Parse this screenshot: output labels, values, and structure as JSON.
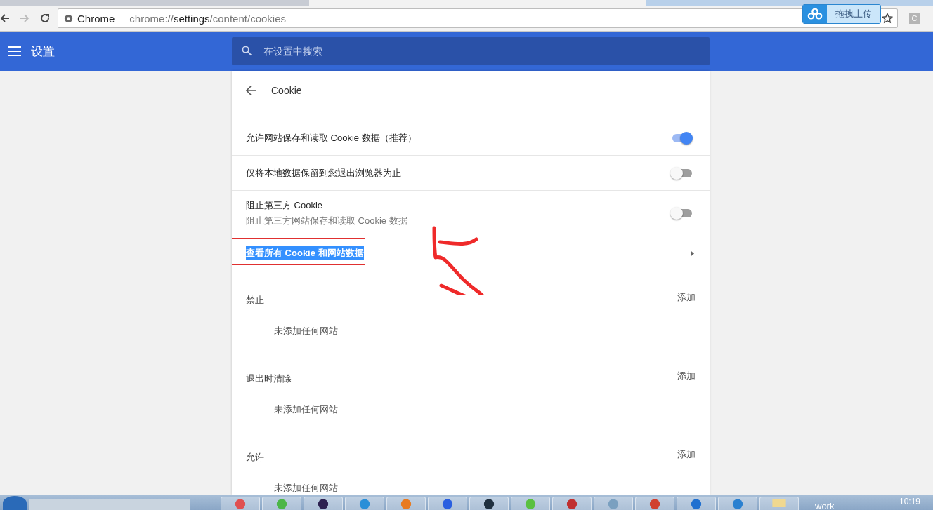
{
  "browser": {
    "origin": "Chrome",
    "url_scheme": "chrome://",
    "url_host": "settings",
    "url_path": "/content/cookies",
    "extension_label": "拖拽上传",
    "profile_badge": "C"
  },
  "header": {
    "title": "设置",
    "search_placeholder": "在设置中搜索"
  },
  "page": {
    "title": "Cookie"
  },
  "toggles": [
    {
      "label": "允许网站保存和读取 Cookie 数据（推荐）",
      "on": true
    },
    {
      "label": "仅将本地数据保留到您退出浏览器为止",
      "on": false
    },
    {
      "label": "阻止第三方 Cookie",
      "sublabel": "阻止第三方网站保存和读取 Cookie 数据",
      "on": false
    }
  ],
  "link_row": {
    "label": "查看所有 Cookie 和网站数据",
    "highlighted": true
  },
  "sections": [
    {
      "title": "禁止",
      "action": "添加",
      "empty_text": "未添加任何网站"
    },
    {
      "title": "退出时清除",
      "action": "添加",
      "empty_text": "未添加任何网站"
    },
    {
      "title": "允许",
      "action": "添加",
      "empty_text": "未添加任何网站"
    }
  ],
  "taskbar": {
    "window_label": "work",
    "clock": "10:19"
  }
}
